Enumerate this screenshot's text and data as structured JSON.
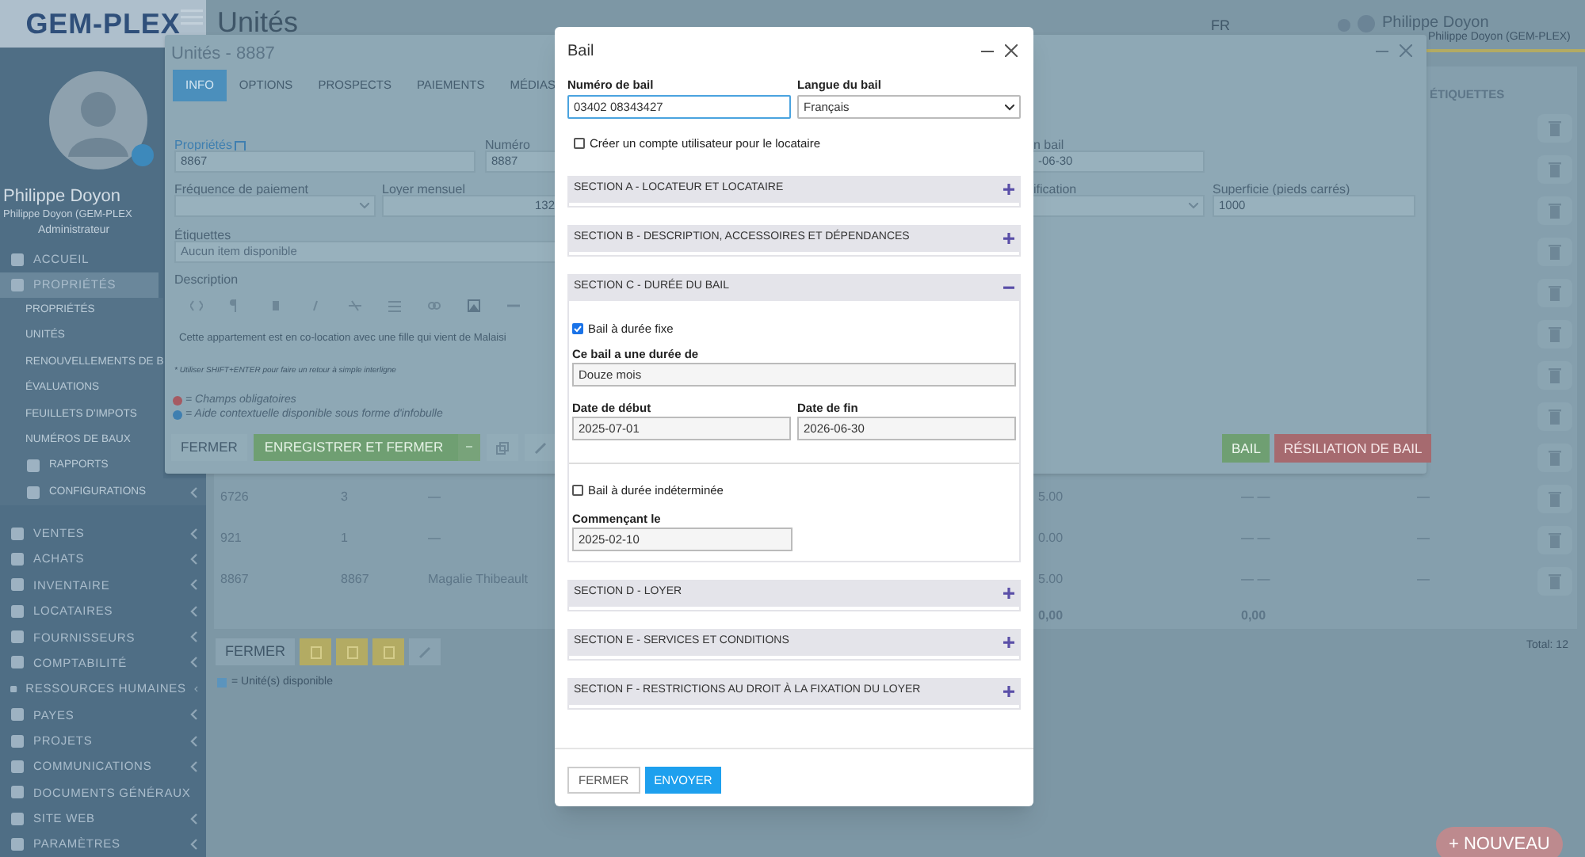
{
  "sidebar": {
    "logo": "GEM-PLEX",
    "user_name": "Philippe Doyon",
    "user_company": "Philippe Doyon (GEM-PLEX",
    "user_role": "Administrateur",
    "items": [
      {
        "label": "ACCUEIL",
        "has_submenu": false,
        "expanded": false
      },
      {
        "label": "PROPRIÉTÉS",
        "has_submenu": false,
        "expanded": true,
        "children": [
          {
            "label": "PROPRIÉTÉS",
            "kind": "plain",
            "has_submenu": false
          },
          {
            "label": "UNITÉS",
            "kind": "plain",
            "has_submenu": false
          },
          {
            "label": "RENOUVELLEMENTS DE B",
            "kind": "plain",
            "has_submenu": false
          },
          {
            "label": "ÉVALUATIONS",
            "kind": "plain",
            "has_submenu": false
          },
          {
            "label": "FEUILLETS D'IMPOTS",
            "kind": "plain",
            "has_submenu": false
          },
          {
            "label": "NUMÉROS DE BAUX",
            "kind": "plain",
            "has_submenu": false
          },
          {
            "label": "RAPPORTS",
            "kind": "icon",
            "has_submenu": false
          },
          {
            "label": "CONFIGURATIONS",
            "kind": "icon",
            "has_submenu": true
          }
        ]
      },
      {
        "label": "VENTES",
        "has_submenu": true,
        "expanded": false
      },
      {
        "label": "ACHATS",
        "has_submenu": true,
        "expanded": false
      },
      {
        "label": "INVENTAIRE",
        "has_submenu": true,
        "expanded": false
      },
      {
        "label": "LOCATAIRES",
        "has_submenu": true,
        "expanded": false
      },
      {
        "label": "FOURNISSEURS",
        "has_submenu": true,
        "expanded": false
      },
      {
        "label": "COMPTABILITÉ",
        "has_submenu": true,
        "expanded": false
      },
      {
        "label": "RESSOURCES HUMAINES",
        "has_submenu": true,
        "expanded": false
      },
      {
        "label": "PAYES",
        "has_submenu": true,
        "expanded": false
      },
      {
        "label": "PROJETS",
        "has_submenu": true,
        "expanded": false
      },
      {
        "label": "COMMUNICATIONS",
        "has_submenu": true,
        "expanded": false
      },
      {
        "label": "DOCUMENTS GÉNÉRAUX",
        "has_submenu": false,
        "expanded": false
      },
      {
        "label": "SITE WEB",
        "has_submenu": true,
        "expanded": false
      },
      {
        "label": "PARAMÈTRES",
        "has_submenu": true,
        "expanded": false
      }
    ]
  },
  "topbar": {
    "page_title": "Unités",
    "language": "FR",
    "user_name": "Philippe Doyon",
    "user_company": "Philippe Doyon (GEM-PLEX)"
  },
  "list": {
    "column_header": "ÉTIQUETTES",
    "rows": [
      {
        "cells": [
          "6726",
          "3",
          "—"
        ],
        "right_cells": [
          "5.00",
          "— —",
          "—"
        ]
      },
      {
        "cells": [
          "921",
          "1",
          "—"
        ],
        "right_cells": [
          "0.00",
          "— —",
          "—"
        ]
      },
      {
        "cells": [
          "8867",
          "8867",
          "Magalie Thibeault"
        ],
        "right_cells": [
          "5.00",
          "— —",
          "—"
        ]
      }
    ],
    "totals": [
      "0,00",
      "0,00"
    ],
    "close_button": "FERMER",
    "legend": "= Unité(s) disponible",
    "total": "Total: 12",
    "new_button": "+ NOUVEAU"
  },
  "unit_dialog": {
    "title": "Unités - 8887",
    "tabs": [
      {
        "label": "INFO",
        "selected": true
      },
      {
        "label": "OPTIONS",
        "selected": false
      },
      {
        "label": "PROSPECTS",
        "selected": false
      },
      {
        "label": "PAIEMENTS",
        "selected": false
      },
      {
        "label": "MÉDIAS",
        "selected": false
      }
    ],
    "property_label": "Propriétés",
    "property_value": "8867",
    "number_label": "Numéro",
    "number_value": "8887",
    "lease_end_label": "n bail",
    "lease_end_value": "-06-30",
    "frequency_label": "Fréquence de paiement",
    "rent_label": "Loyer mensuel",
    "rent_value": "132",
    "classification_label": "ification",
    "area_label": "Superficie (pieds carrés)",
    "area_value": "1000",
    "tags_label": "Étiquettes",
    "tags_placeholder": "Aucun item disponible",
    "description_label": "Description",
    "description_text": "Cette appartement est en co-location avec une fille qui vient de Malaisi",
    "editor_hint": "* Utiliser SHIFT+ENTER pour faire un retour à simple interligne",
    "legend_required": "= Champs obligatoires",
    "legend_help": "= Aide contextuelle disponible sous forme d'infobulle",
    "close_button": "FERMER",
    "save_button": "ENREGISTRER ET FERMER",
    "lease_button": "BAIL",
    "termination_button": "RÉSILIATION DE BAIL"
  },
  "lease_modal": {
    "title": "Bail",
    "number_label": "Numéro de bail",
    "number_value": "03402 08343427",
    "language_label": "Langue du bail",
    "language_value": "Français",
    "create_account": {
      "label": "Créer un compte utilisateur pour le locataire",
      "checked": false
    },
    "sections": [
      {
        "title": "SECTION A - LOCATEUR ET LOCATAIRE",
        "expanded": false
      },
      {
        "title": "SECTION B - DESCRIPTION, ACCESSOIRES ET DÉPENDANCES",
        "expanded": false
      },
      {
        "title": "SECTION C - DURÉE DU BAIL",
        "expanded": true,
        "fixed": {
          "label": "Bail à durée fixe",
          "checked": true
        },
        "duration_label": "Ce bail a une durée de",
        "duration_value": "Douze mois",
        "start_label": "Date de début",
        "start_value": "2025-07-01",
        "end_label": "Date de fin",
        "end_value": "2026-06-30",
        "indefinite": {
          "label": "Bail à durée indéterminée",
          "checked": false
        },
        "from_label": "Commençant le",
        "from_value": "2025-02-10"
      },
      {
        "title": "SECTION D - LOYER",
        "expanded": false
      },
      {
        "title": "SECTION E - SERVICES ET CONDITIONS",
        "expanded": false
      },
      {
        "title": "SECTION F - RESTRICTIONS AU DROIT À LA FIXATION DU LOYER",
        "expanded": false
      }
    ],
    "close_button": "FERMER",
    "send_button": "ENVOYER"
  }
}
